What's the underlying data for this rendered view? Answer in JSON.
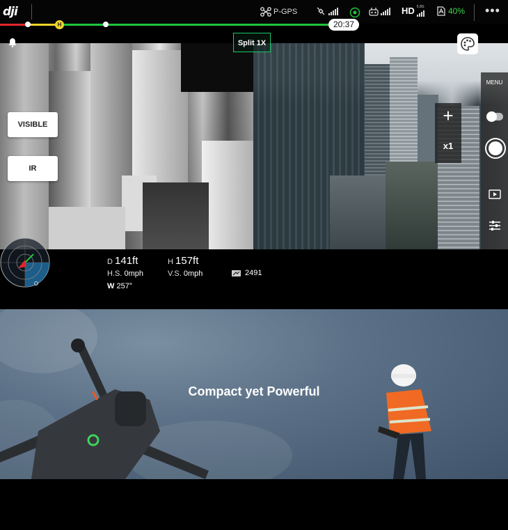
{
  "status_bar": {
    "logo": "dji",
    "gps_label": "P-GPS",
    "hd_label": "HD",
    "band_label": "5.8G",
    "battery": "40%",
    "more": "•••"
  },
  "flight_line": {
    "home_marker": "H",
    "time_remaining": "20:37"
  },
  "camera": {
    "split_badge": "Split 1X",
    "mode_buttons": [
      "VISIBLE",
      "IR"
    ],
    "zoom_plus": "+",
    "zoom_level": "x1",
    "menu_label": "MENU"
  },
  "telemetry": {
    "distance_prefix": "D",
    "distance_value": "141ft",
    "height_prefix": "H",
    "height_value": "157ft",
    "hs_label": "H.S.",
    "hs_value": "0mph",
    "vs_label": "V.S.",
    "vs_value": "0mph",
    "heading_label": "W",
    "heading_value": "257°",
    "altitude_value": "2491"
  },
  "promo": {
    "title": "Compact yet Powerful"
  },
  "icons": {
    "drone_icon": "drone-icon",
    "satellite_icon": "satellite-icon",
    "rc_icon": "remote-controller-icon",
    "battery_icon": "battery-icon",
    "bell_icon": "bell-icon",
    "palette_icon": "palette-icon",
    "playback_icon": "playback-icon",
    "sliders_icon": "sliders-icon"
  },
  "colors": {
    "battery_green": "#3fd34d",
    "track_green": "#1fc43a",
    "track_red": "#e0262b",
    "home_yellow": "#f0d32a",
    "split_border": "#19c86b"
  }
}
